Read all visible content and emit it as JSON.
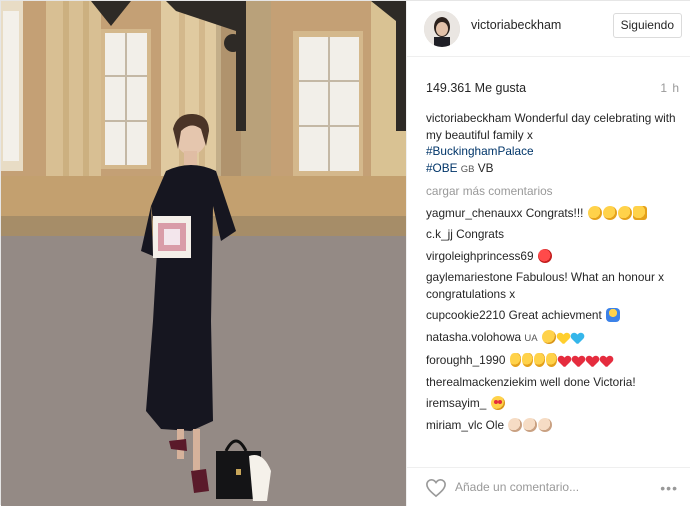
{
  "post": {
    "author": "victoriabeckham",
    "follow_label": "Siguiendo",
    "likes": "149.361 Me gusta",
    "time": "1 h",
    "caption_user": "victoriabeckham",
    "caption_text": "Wonderful day celebrating with my beautiful family x",
    "hashtag_1": "#BuckinghamPalace",
    "hashtag_2": "#OBE",
    "caption_suffix": "VB",
    "caption_flag": "GB",
    "load_more": "cargar más comentarios"
  },
  "comments": [
    {
      "user": "yagmur_chenauxx",
      "text": "Congrats!!!",
      "emoji": "clapping-hands, clapping-hands, clapping-hands, thumbs-up"
    },
    {
      "user": "c.k_jj",
      "text": "Congrats",
      "emoji": ""
    },
    {
      "user": "virgoleighprincess69",
      "text": "",
      "emoji": "apple"
    },
    {
      "user": "gaylemariestone",
      "text": "Fabulous! What an honour x congratulations x",
      "emoji": ""
    },
    {
      "user": "cupcookie2210",
      "text": "Great achievment",
      "emoji": "person-raising-hand"
    },
    {
      "user": "natasha.volohowa",
      "text": "UA",
      "emoji": "face, yellow-heart, blue-heart"
    },
    {
      "user": "foroughh_1990",
      "text": "",
      "emoji": "ok-hand x4, red-heart x4"
    },
    {
      "user": "therealmackenziekim",
      "text": "well done Victoria!",
      "emoji": ""
    },
    {
      "user": "iremsayim_",
      "text": "",
      "emoji": "heart-eyes-face"
    },
    {
      "user": "miriam_vlc",
      "text": "Ole",
      "emoji": "clapping-hands x3"
    }
  ],
  "footer": {
    "comment_placeholder": "Añade un comentario...",
    "more_symbol": "•••"
  }
}
